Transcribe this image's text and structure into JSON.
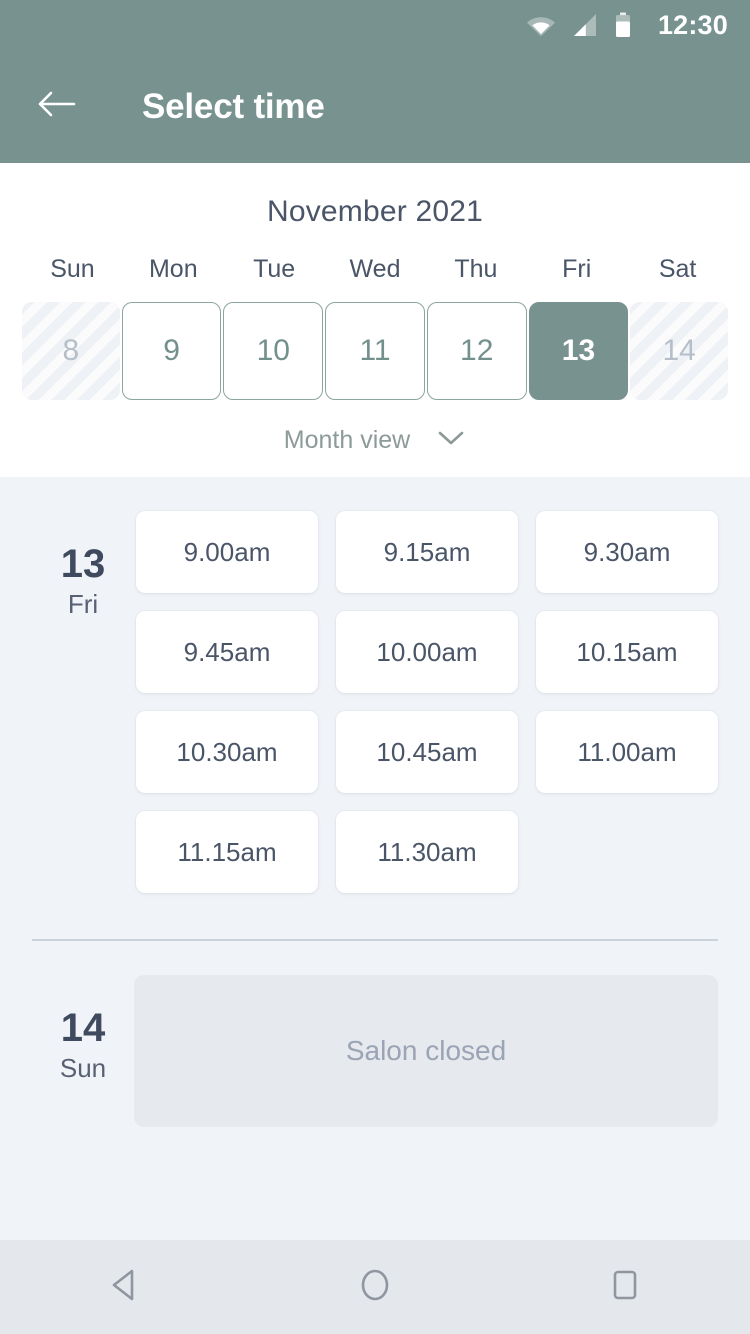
{
  "status_bar": {
    "time": "12:30",
    "icons": [
      "wifi-icon",
      "cellular-signal-icon",
      "battery-icon"
    ]
  },
  "app_bar": {
    "back_icon": "back-arrow-icon",
    "title": "Select time"
  },
  "calendar": {
    "month_label": "November 2021",
    "day_of_week_headers": [
      "Sun",
      "Mon",
      "Tue",
      "Wed",
      "Thu",
      "Fri",
      "Sat"
    ],
    "days": [
      {
        "number": "8",
        "state": "disabled"
      },
      {
        "number": "9",
        "state": "enabled"
      },
      {
        "number": "10",
        "state": "enabled"
      },
      {
        "number": "11",
        "state": "enabled"
      },
      {
        "number": "12",
        "state": "enabled"
      },
      {
        "number": "13",
        "state": "selected"
      },
      {
        "number": "14",
        "state": "disabled"
      }
    ],
    "view_toggle_label": "Month view",
    "view_toggle_icon": "chevron-down-icon"
  },
  "schedule": [
    {
      "date_number": "13",
      "date_dow": "Fri",
      "closed": false,
      "slots": [
        "9.00am",
        "9.15am",
        "9.30am",
        "9.45am",
        "10.00am",
        "10.15am",
        "10.30am",
        "10.45am",
        "11.00am",
        "11.15am",
        "11.30am"
      ]
    },
    {
      "date_number": "14",
      "date_dow": "Sun",
      "closed": true,
      "closed_label": "Salon closed",
      "slots": []
    }
  ],
  "nav_bar": {
    "buttons": [
      {
        "name": "back-triangle-icon"
      },
      {
        "name": "home-circle-icon"
      },
      {
        "name": "recents-square-icon"
      }
    ]
  },
  "colors": {
    "brand_sage": "#78938f",
    "page_bg": "#f0f3f7",
    "card_white": "#ffffff",
    "text_slate": "#4a5568",
    "text_slate_dark": "#3f4a5e",
    "muted": "#9aa4b4",
    "closed_card_bg": "#e6e9ee",
    "nav_bar_bg": "#e4e7ec"
  }
}
